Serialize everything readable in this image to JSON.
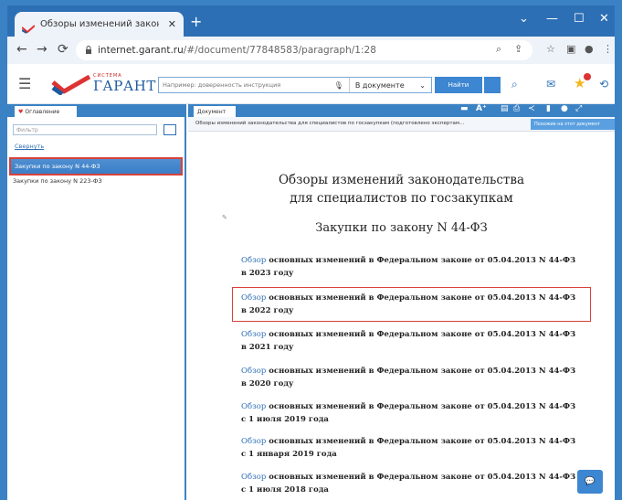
{
  "browser": {
    "tab_title": "Обзоры изменений законодател",
    "tab_close": "✕",
    "new_tab": "+",
    "url_host": "internet.garant.ru",
    "url_path": "/#/document/77848583/paragraph/1:28",
    "window_controls": [
      "⌄",
      "—",
      "☐",
      "✕"
    ]
  },
  "toolbar": {
    "logo_small": "СИСТЕМА",
    "logo_text": "ГАРАНТ",
    "search_placeholder": "Например: доверенность инструкция",
    "search_scope": "В документе",
    "find_label": "Найти"
  },
  "left_panel": {
    "tab_label": "Оглавление",
    "filter_placeholder": "Фильтр",
    "collapse_label": "Свернуть",
    "items": [
      {
        "label": "Закупки по закону N 44-ФЗ"
      },
      {
        "label": "Закупки по закону N 223-ФЗ"
      }
    ]
  },
  "document": {
    "tab_label": "Документ",
    "subtitle": "Обзоры изменений законодательства для специалистов по госзакупкам (подготовлено экспертам...",
    "sublink": "Похожие на этот документ",
    "title_line1": "Обзоры изменений законодательства",
    "title_line2": "для специалистов по госзакупкам",
    "section_title": "Закупки по закону N 44-ФЗ",
    "link_word": "Обзор",
    "entries": [
      {
        "text": " основных изменений в Федеральном законе от 05.04.2013 N 44-ФЗ",
        "date": "в 2023 году"
      },
      {
        "text": " основных изменений в Федеральном законе от 05.04.2013 N 44-ФЗ",
        "date": "в 2022 году"
      },
      {
        "text": " основных изменений в Федеральном законе от 05.04.2013 N 44-ФЗ",
        "date": "в 2021 году"
      },
      {
        "text": " основных изменений в Федеральном законе от 05.04.2013 N 44-ФЗ",
        "date": "в 2020 году"
      },
      {
        "text": " основных изменений в Федеральном законе от 05.04.2013 N 44-ФЗ",
        "date": "с 1 июля 2019 года"
      },
      {
        "text": " основных изменений в Федеральном законе от 05.04.2013 N 44-ФЗ",
        "date": "с 1 января 2019 года"
      },
      {
        "text": " основных изменений в Федеральном законе от 05.04.2013 N 44-ФЗ",
        "date": "с 1 июля 2018 года"
      }
    ]
  },
  "colors": {
    "frame_blue": "#3b82c4",
    "link_blue": "#2d6fb5",
    "highlight_red": "#d9413a"
  }
}
